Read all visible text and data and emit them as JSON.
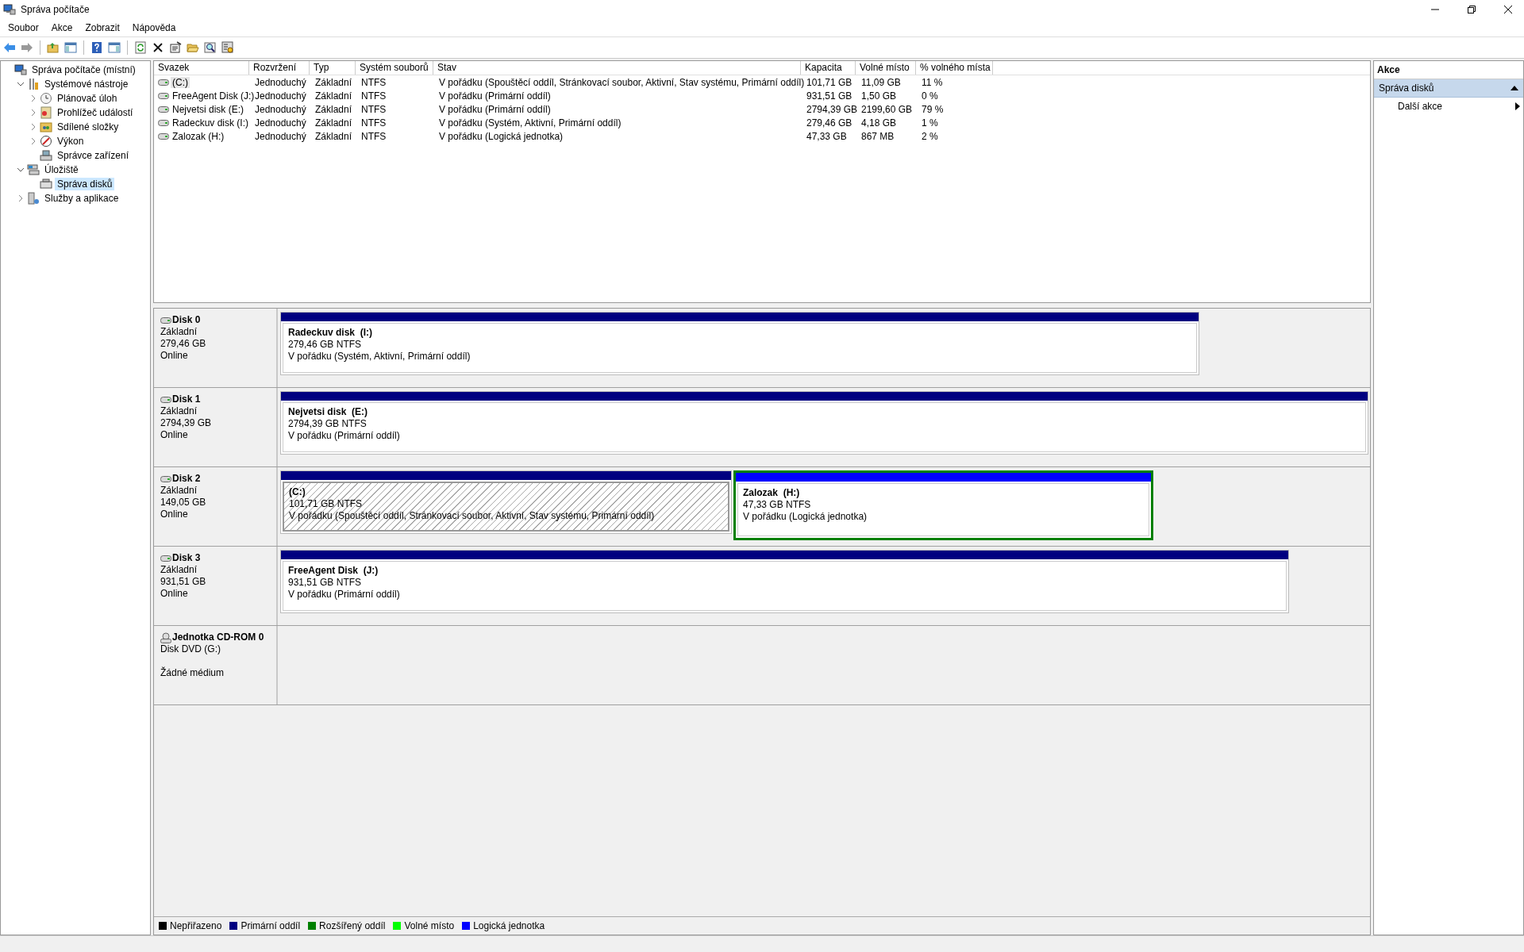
{
  "window": {
    "title": "Správa počítače"
  },
  "menu": [
    "Soubor",
    "Akce",
    "Zobrazit",
    "Nápověda"
  ],
  "tree": [
    {
      "label": "Správa počítače (místní)",
      "kind": "computer",
      "selected": false,
      "children": [
        {
          "label": "Systémové nástroje",
          "kind": "tools",
          "expanded": true,
          "selected": false,
          "children": [
            {
              "label": "Plánovač úloh",
              "kind": "clock",
              "expanded": false,
              "selected": false
            },
            {
              "label": "Prohlížeč událostí",
              "kind": "events",
              "expanded": false,
              "selected": false
            },
            {
              "label": "Sdílené složky",
              "kind": "share",
              "expanded": false,
              "selected": false
            },
            {
              "label": "Výkon",
              "kind": "performance",
              "expanded": false,
              "selected": false
            },
            {
              "label": "Správce zařízení",
              "kind": "devices",
              "selected": false
            }
          ]
        },
        {
          "label": "Úložiště",
          "kind": "storage",
          "expanded": true,
          "selected": false,
          "children": [
            {
              "label": "Správa disků",
              "kind": "disk",
              "selected": true
            }
          ]
        },
        {
          "label": "Služby a aplikace",
          "kind": "services",
          "expanded": false,
          "selected": false
        }
      ]
    }
  ],
  "table": {
    "columns": [
      "Svazek",
      "Rozvržení",
      "Typ",
      "Systém souborů",
      "Stav",
      "Kapacita",
      "Volné místo",
      "% volného místa"
    ],
    "rows": [
      {
        "selected": true,
        "cells": [
          "(C:)",
          "Jednoduchý",
          "Základní",
          "NTFS",
          "V pořádku (Spouštěcí oddíl, Stránkovací soubor, Aktivní, Stav systému, Primární oddíl)",
          "101,71 GB",
          "11,09 GB",
          "11 %"
        ]
      },
      {
        "selected": false,
        "cells": [
          "FreeAgent Disk (J:)",
          "Jednoduchý",
          "Základní",
          "NTFS",
          "V pořádku (Primární oddíl)",
          "931,51 GB",
          "1,50 GB",
          "0 %"
        ]
      },
      {
        "selected": false,
        "cells": [
          "Nejvetsi disk (E:)",
          "Jednoduchý",
          "Základní",
          "NTFS",
          "V pořádku (Primární oddíl)",
          "2794,39 GB",
          "2199,60 GB",
          "79 %"
        ]
      },
      {
        "selected": false,
        "cells": [
          "Radeckuv disk (I:)",
          "Jednoduchý",
          "Základní",
          "NTFS",
          "V pořádku (Systém, Aktivní, Primární oddíl)",
          "279,46 GB",
          "4,18 GB",
          "1 %"
        ]
      },
      {
        "selected": false,
        "cells": [
          "Zalozak (H:)",
          "Jednoduchý",
          "Základní",
          "NTFS",
          "V pořádku (Logická jednotka)",
          "47,33 GB",
          "867 MB",
          "2 %"
        ]
      }
    ]
  },
  "disks": [
    {
      "name": "Disk 0",
      "kind": "disk",
      "type": "Základní",
      "size": "279,46 GB",
      "status": "Online",
      "partitions": [
        {
          "name": "Radeckuv disk  (I:)",
          "size": "279,46 GB NTFS",
          "status": "V pořádku (Systém, Aktivní, Primární oddíl)",
          "kind": "primary",
          "selected": false
        }
      ]
    },
    {
      "name": "Disk 1",
      "kind": "disk",
      "type": "Základní",
      "size": "2794,39 GB",
      "status": "Online",
      "partitions": [
        {
          "name": "Nejvetsi disk  (E:)",
          "size": "2794,39 GB NTFS",
          "status": "V pořádku (Primární oddíl)",
          "kind": "primary",
          "selected": false
        }
      ]
    },
    {
      "name": "Disk 2",
      "kind": "disk",
      "type": "Základní",
      "size": "149,05 GB",
      "status": "Online",
      "partitions": [
        {
          "name": "(C:)",
          "size": "101,71 GB NTFS",
          "status": "V pořádku (Spouštěcí oddíl, Stránkovací soubor, Aktivní, Stav systému, Primární oddíl)",
          "kind": "primary",
          "selected": true
        },
        {
          "name": "Zalozak  (H:)",
          "size": "47,33 GB NTFS",
          "status": "V pořádku (Logická jednotka)",
          "kind": "logical",
          "selected": false
        }
      ]
    },
    {
      "name": "Disk 3",
      "kind": "disk",
      "type": "Základní",
      "size": "931,51 GB",
      "status": "Online",
      "partitions": [
        {
          "name": "FreeAgent Disk  (J:)",
          "size": "931,51 GB NTFS",
          "status": "V pořádku (Primární oddíl)",
          "kind": "primary",
          "selected": false
        }
      ]
    },
    {
      "name": "Jednotka CD-ROM 0",
      "kind": "cdrom",
      "type": "Disk DVD (G:)",
      "status": "Žádné médium"
    }
  ],
  "legend": [
    {
      "label": "Nepřiřazeno",
      "color": "#000000"
    },
    {
      "label": "Primární oddíl",
      "color": "#000080"
    },
    {
      "label": "Rozšířený oddíl",
      "color": "#008000"
    },
    {
      "label": "Volné místo",
      "color": "#00ff00"
    },
    {
      "label": "Logická jednotka",
      "color": "#0000ff"
    }
  ],
  "actions": {
    "title": "Akce",
    "section": {
      "label": "Správa disků",
      "expanded": true
    },
    "items": [
      "Další akce"
    ]
  }
}
